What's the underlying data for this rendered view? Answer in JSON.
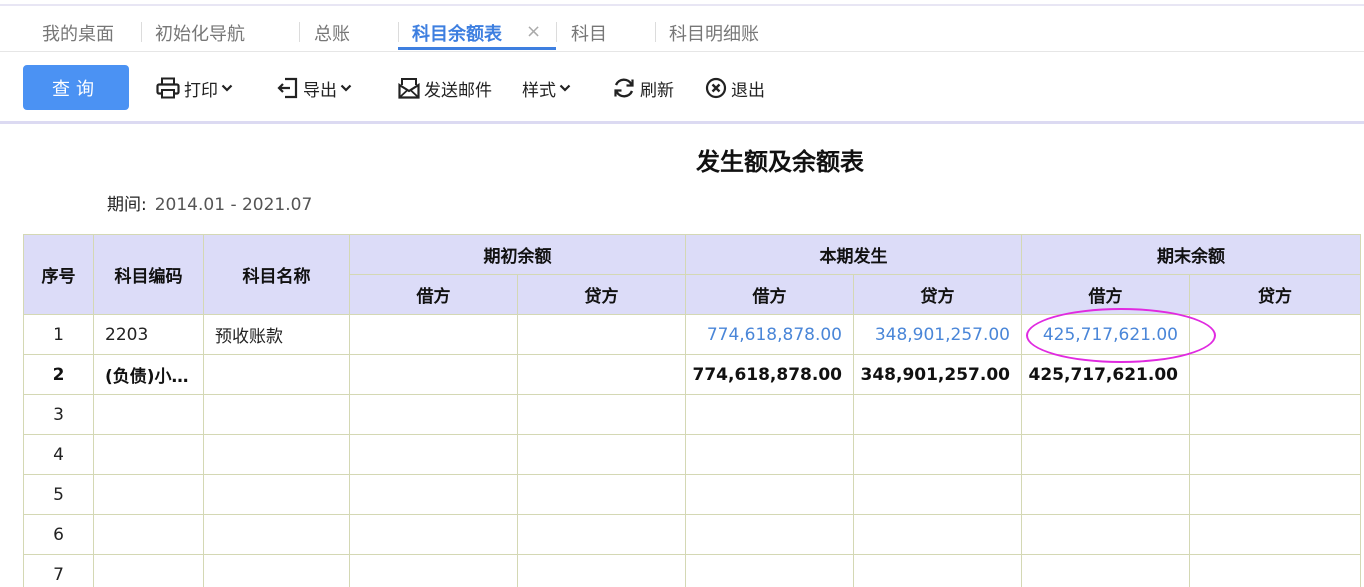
{
  "tabs": [
    {
      "label": "我的桌面"
    },
    {
      "label": "初始化导航"
    },
    {
      "label": "总账"
    },
    {
      "label": "科目余额表"
    },
    {
      "label": "科目"
    },
    {
      "label": "科目明细账"
    }
  ],
  "tab_close": "×",
  "toolbar": {
    "query": "查询",
    "print": "打印",
    "export": "导出",
    "email": "发送邮件",
    "style": "样式",
    "refresh": "刷新",
    "exit": "退出"
  },
  "report": {
    "title": "发生额及余额表",
    "period_label": "期间:",
    "period_value": "2014.01 - 2021.07"
  },
  "table": {
    "headers": {
      "index": "序号",
      "code": "科目编码",
      "name": "科目名称",
      "opening": "期初余额",
      "current": "本期发生",
      "closing": "期末余额",
      "debit": "借方",
      "credit": "贷方"
    },
    "rows": [
      {
        "no": "1",
        "code": "2203",
        "name": "预收账款",
        "open_debit": "",
        "open_credit": "",
        "cur_debit": "774,618,878.00",
        "cur_credit": "348,901,257.00",
        "close_debit": "425,717,621.00",
        "close_credit": ""
      },
      {
        "no": "2",
        "code": "(负债)小…",
        "name": "",
        "open_debit": "",
        "open_credit": "",
        "cur_debit": "774,618,878.00",
        "cur_credit": "348,901,257.00",
        "close_debit": "425,717,621.00",
        "close_credit": ""
      },
      {
        "no": "3"
      },
      {
        "no": "4"
      },
      {
        "no": "5"
      },
      {
        "no": "6"
      },
      {
        "no": "7"
      }
    ]
  },
  "colors": {
    "accent": "#3e7fe0",
    "button": "#4b92f3",
    "link": "#4a86d8",
    "header_bg": "#dcdcf8",
    "annotation": "#e02ae0"
  }
}
